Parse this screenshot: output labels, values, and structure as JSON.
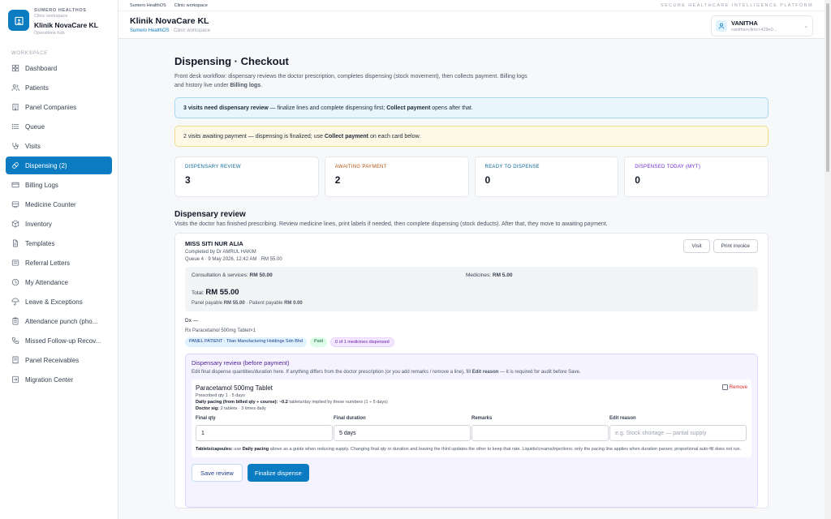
{
  "brand": {
    "org": "SUMERO HEALTHOS",
    "sub": "Clinic workspace",
    "clinic": "Klinik NovaCare KL",
    "hub": "Operations hub"
  },
  "sidebar": {
    "section_label": "WORKSPACE",
    "items": [
      {
        "label": "Dashboard",
        "icon": "grid-icon"
      },
      {
        "label": "Patients",
        "icon": "users-icon"
      },
      {
        "label": "Panel Companies",
        "icon": "building-icon"
      },
      {
        "label": "Queue",
        "icon": "list-icon"
      },
      {
        "label": "Visits",
        "icon": "stethoscope-icon"
      },
      {
        "label": "Dispensing (2)",
        "icon": "pill-icon",
        "active": true
      },
      {
        "label": "Billing Logs",
        "icon": "card-icon"
      },
      {
        "label": "Medicine Counter",
        "icon": "counter-icon"
      },
      {
        "label": "Inventory",
        "icon": "box-icon"
      },
      {
        "label": "Templates",
        "icon": "file-icon"
      },
      {
        "label": "Referral Letters",
        "icon": "letter-icon"
      },
      {
        "label": "My Attendance",
        "icon": "clock-icon"
      },
      {
        "label": "Leave & Exceptions",
        "icon": "umbrella-icon"
      },
      {
        "label": "Attendance punch (pho...",
        "icon": "clipboard-icon"
      },
      {
        "label": "Missed Follow-up Recov...",
        "icon": "phone-icon"
      },
      {
        "label": "Panel Receivables",
        "icon": "receipt-icon"
      },
      {
        "label": "Migration Center",
        "icon": "migrate-icon"
      }
    ]
  },
  "topstrip": {
    "crumb1": "Sumero HealthOS",
    "crumb2": "Clinic workspace",
    "tagline": "SECURE HEALTHCARE INTELLIGENCE PLATFORM"
  },
  "header": {
    "title": "Klinik NovaCare KL",
    "sub_link": "Sumero HealthOS",
    "sub_rest": " · Clinic workspace"
  },
  "user": {
    "name": "VANITHA",
    "email": "vanitha+clinic+429e0..."
  },
  "page": {
    "title": "Dispensing · Checkout",
    "desc_pre": "Front desk workflow: dispensary reviews the doctor prescription, completes dispensing (stock movement), then collects payment. Billing logs and history live under ",
    "desc_bold": "Billing logs",
    "desc_post": "."
  },
  "banner_blue": {
    "pre": "3 visits need ",
    "b1": "dispensary review",
    "mid": " — finalize lines and complete dispensing first; ",
    "b2": "Collect payment",
    "post": " opens after that."
  },
  "banner_yellow": {
    "pre": "2 visits awaiting payment — dispensing is finalized; use ",
    "b1": "Collect payment",
    "post": " on each card below."
  },
  "stats": [
    {
      "label": "DISPENSARY REVIEW",
      "value": "3",
      "color": "#0b6a9c"
    },
    {
      "label": "AWAITING PAYMENT",
      "value": "2",
      "color": "#b45309"
    },
    {
      "label": "READY TO DISPENSE",
      "value": "0",
      "color": "#0b6a9c"
    },
    {
      "label": "DISPENSED TODAY (MYT)",
      "value": "0",
      "color": "#6d28d9"
    }
  ],
  "review_section": {
    "title": "Dispensary review",
    "desc": "Visits the doctor has finished prescribing. Review medicine lines, print labels if needed, then complete dispensing (stock deducts). After that, they move to awaiting payment."
  },
  "visit": {
    "patient": "MISS SITI NUR ALIA",
    "completed_by": "Completed by Dr AMRUL HAKIM",
    "queue_line": "Queue 4 · 9 May 2026, 12:42 AM · RM 55.00",
    "visit_btn": "Visit",
    "print_btn": "Print invoice",
    "consult_label": "Consultation & services: ",
    "consult_value": "RM 50.00",
    "med_label": "Medicines: ",
    "med_value": "RM 5.00",
    "total_label": "Total: ",
    "total_value": "RM 55.00",
    "panel_payable_label": "Panel payable ",
    "panel_payable_value": "RM 55.00",
    "patient_payable_label": " · Patient payable ",
    "patient_payable_value": "RM 0.00",
    "dx": "Dx —",
    "rx": "Rx Paracetamol 500mg Tablet×1",
    "badges": [
      {
        "text": "PANEL PATIENT · Titan Manufacturing Holdings Sdn Bhd",
        "kind": "blue"
      },
      {
        "text": "Paid",
        "kind": "green"
      },
      {
        "text": "0 of 1 medicines dispensed",
        "kind": "purple"
      }
    ]
  },
  "review_panel": {
    "title": "Dispensary review (before payment)",
    "desc_pre": "Edit final dispense quantities/duration here. If anything differs from the doctor prescription (or you add remarks / remove a line), fill ",
    "desc_bold": "Edit reason",
    "desc_post": " — it is required for audit before Save.",
    "med_name": "Paracetamol 500mg Tablet",
    "prescribed": "Prescribed qty 1 · 5 days",
    "pacing_label": "Daily pacing (from billed qty ÷ course): ",
    "pacing_value": "~0.2",
    "pacing_rest": " tablets/day implied by these numbers (1 ÷ 5 days)",
    "doctor_sig_label": "Doctor sig: ",
    "doctor_sig_value": "2 tablets · 3 times daily",
    "remove_label": "Remove",
    "labels": [
      "Final qty",
      "Final duration",
      "Remarks",
      "Edit reason"
    ],
    "final_qty": "1",
    "final_duration": "5 days",
    "remarks": "",
    "edit_reason_placeholder": "e.g. Stock shortage — partial supply",
    "hint_b1": "Tablets/capsules:",
    "hint_1": " use ",
    "hint_b2": "Daily pacing",
    "hint_2": " above as a guide when reducing supply. Changing final qty or duration and leaving the third updates the other to keep that rate. Liquids/creams/injections: only the pacing line applies when duration parses; proportional auto-fill does not run.",
    "save_btn": "Save review",
    "finalize_btn": "Finalize dispense"
  },
  "colors": {
    "accent": "#0b7cc1",
    "danger": "#dc2626"
  }
}
